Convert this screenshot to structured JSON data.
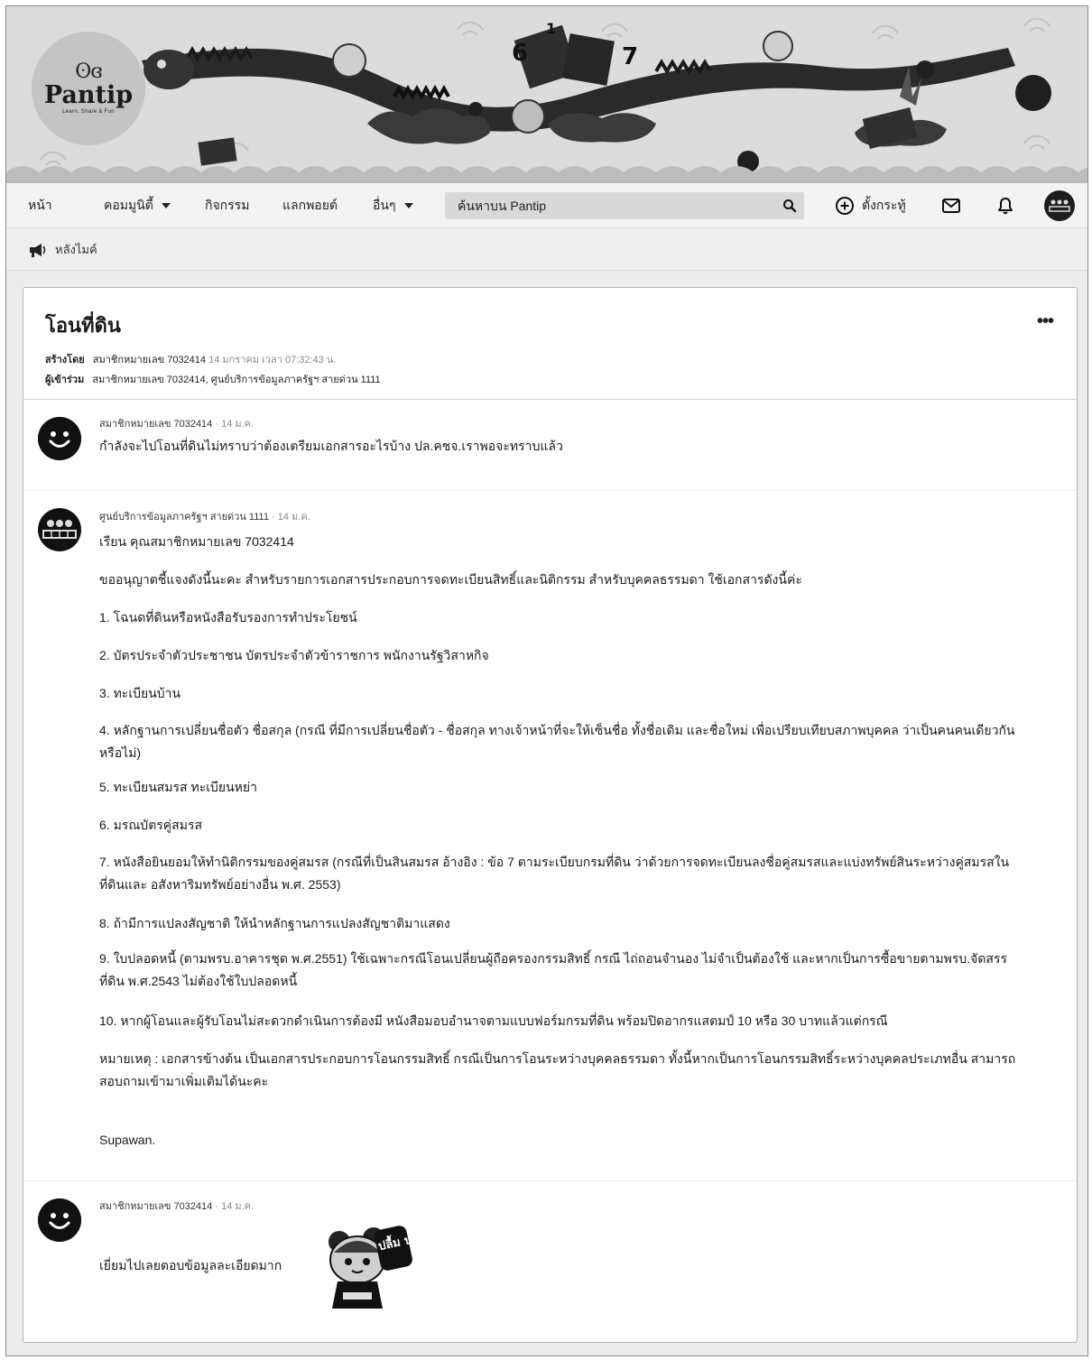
{
  "site": {
    "logo_mark": "ʘɞ",
    "logo_text": "Pantip",
    "logo_tagline": "Learn, Share & Fun"
  },
  "nav": {
    "home": "หน้า",
    "community": "คอมมูนิตี้",
    "activities": "กิจกรรม",
    "points": "แลกพอยต์",
    "more": "อื่นๆ",
    "search_placeholder": "ค้นหาบน Pantip",
    "new_topic": "ตั้งกระทู้"
  },
  "breadcrumb": {
    "label": "หลังไมค์"
  },
  "topic": {
    "title": "โอนที่ดิน",
    "more_label": "•••",
    "created_by_label": "สร้างโดย",
    "created_by": "สมาชิกหมายเลข 7032414",
    "created_time": "14 มกราคม เวลา 07:32:43 น.",
    "participants_label": "ผู้เข้าร่วม",
    "participants": "สมาชิกหมายเลข 7032414, ศูนย์บริการข้อมูลภาครัฐฯ สายด่วน 1111"
  },
  "comments": [
    {
      "author": "สมาชิกหมายเลข 7032414",
      "time": "· 14 ม.ค.",
      "text": "กำลังจะไปโอนที่ดินไม่ทราบว่าต้องเตรียมเอกสารอะไรบ้าง ปล.คชจ.เราพอจะทราบแล้ว"
    },
    {
      "author": "ศูนย์บริการข้อมูลภาครัฐฯ สายด่วน 1111",
      "time": "· 14 ม.ค.",
      "greeting": "เรียน คุณสมาชิกหมายเลข 7032414",
      "intro": "ขออนุญาตชี้แจงดังนี้นะคะ สำหรับรายการเอกสารประกอบการจดทะเบียนสิทธิ์และนิติกรรม สำหรับบุคคลธรรมดา ใช้เอกสารดังนี้ค่ะ",
      "items": [
        "1. โฉนดที่ดินหรือหนังสือรับรองการทำประโยชน์",
        "2. บัตรประจำตัวประชาชน บัตรประจำตัวข้าราชการ พนักงานรัฐวิสาหกิจ",
        "3. ทะเบียนบ้าน",
        "4. หลักฐานการเปลี่ยนชื่อตัว ชื่อสกุล (กรณี ที่มีการเปลี่ยนชื่อตัว - ชื่อสกุล ทางเจ้าหน้าที่จะให้เซ็นชื่อ ทั้งชื่อเดิม และชื่อใหม่ เพื่อเปรียบเทียบสภาพบุคคล ว่าเป็นคนคนเดียวกันหรือไม่)",
        "5. ทะเบียนสมรส ทะเบียนหย่า",
        "6. มรณบัตรคู่สมรส",
        "7. หนังสือยินยอมให้ทำนิติกรรมของคู่สมรส (กรณีที่เป็นสินสมรส อ้างอิง : ข้อ 7 ตามระเบียบกรมที่ดิน ว่าด้วยการจดทะเบียนลงชื่อคู่สมรสและแบ่งทรัพย์สินระหว่างคู่สมรสในที่ดินและ อสังหาริมทรัพย์อย่างอื่น พ.ศ. 2553)",
        "8. ถ้ามีการแปลงสัญชาติ ให้นำหลักฐานการแปลงสัญชาติมาแสดง",
        "9. ใบปลอดหนี้ (ตามพรบ.อาคารชุด พ.ศ.2551) ใช้เฉพาะกรณีโอนเปลี่ยนผู้ถือครองกรรมสิทธิ์ กรณี ไถ่ถอนจำนอง ไม่จำเป็นต้องใช้ และหากเป็นการซื้อขายตามพรบ.จัดสรรที่ดิน พ.ศ.2543 ไม่ต้องใช้ใบปลอดหนี้",
        "10. หากผู้โอนและผู้รับโอนไม่สะดวกดำเนินการต้องมี หนังสือมอบอำนาจตามแบบฟอร์มกรมที่ดิน พร้อมปิดอากรแสตมป์ 10 หรือ 30 บาทแล้วแต่กรณี"
      ],
      "note": "หมายเหตุ : เอกสารข้างต้น เป็นเอกสารประกอบการโอนกรรมสิทธิ์ กรณีเป็นการโอนระหว่างบุคคลธรรมดา ทั้งนี้หากเป็นการโอนกรรมสิทธิ์ระหว่างบุคคลประเภทอื่น สามารถสอบถามเข้ามาเพิ่มเติมได้นะคะ",
      "signature": "Supawan."
    },
    {
      "author": "สมาชิกหมายเลข 7032414",
      "time": "· 14 ม.ค.",
      "text": "เยี่ยมไปเลยตอบข้อมูลละเอียดมาก",
      "sticker_text": "ปลื้ม ปริ่ม"
    }
  ],
  "icons": {
    "search": "search-icon",
    "add": "plus-circle-icon",
    "mail": "mail-icon",
    "bell": "bell-icon",
    "breadcrumb": "megaphone-icon"
  },
  "colors": {
    "background": "#ececec",
    "card": "#ffffff",
    "nav": "#f3f3f3",
    "search": "#d9d9d9"
  }
}
